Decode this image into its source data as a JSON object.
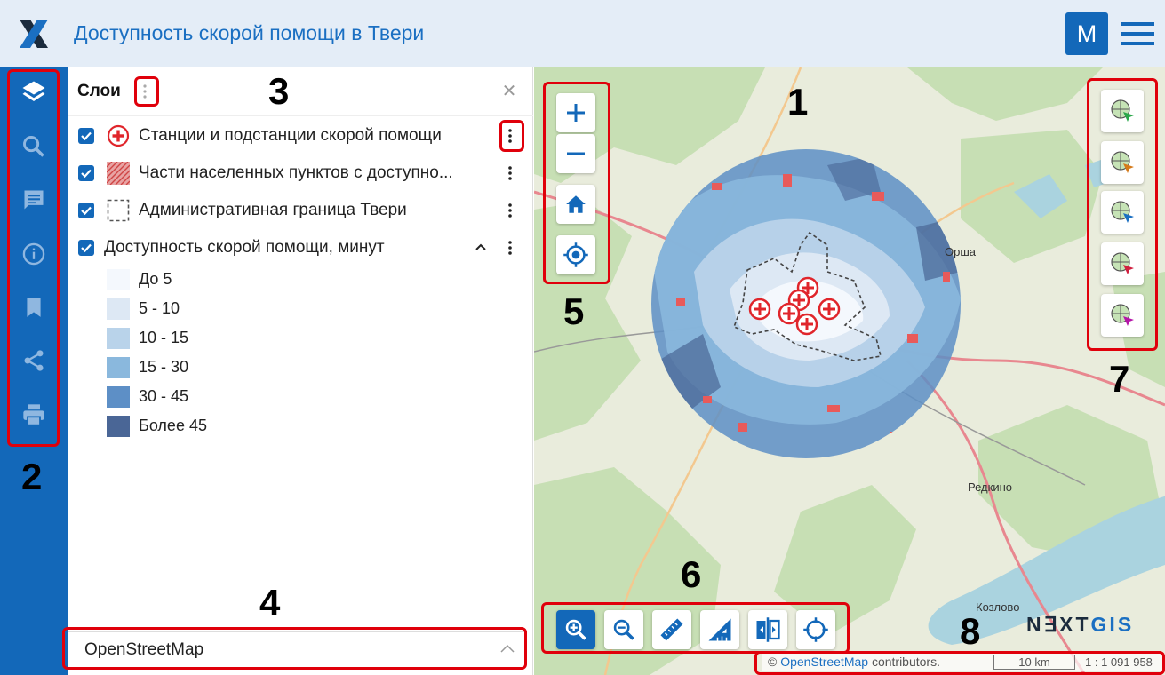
{
  "header": {
    "title": "Доступность скорой помощи в Твери",
    "avatar_letter": "M"
  },
  "panel": {
    "title": "Слои",
    "layers": [
      {
        "label": "Станции и подстанции скорой помощи",
        "checked": true,
        "icon": "ambulance-station-icon"
      },
      {
        "label": "Части населенных пунктов с доступно...",
        "checked": true,
        "icon": "hatched-polygon-icon"
      },
      {
        "label": "Административная граница Твери",
        "checked": true,
        "icon": "dashed-polygon-icon"
      },
      {
        "label": "Доступность скорой помощи, минут",
        "checked": true,
        "icon": "none"
      }
    ],
    "legend": [
      {
        "label": "До 5",
        "color": "#f4f8fd"
      },
      {
        "label": "5 - 10",
        "color": "#dde8f4"
      },
      {
        "label": "10 - 15",
        "color": "#b9d3ea"
      },
      {
        "label": "15 - 30",
        "color": "#8ab8dd"
      },
      {
        "label": "30 - 45",
        "color": "#5d8fc6"
      },
      {
        "label": "Более 45",
        "color": "#4a6696"
      }
    ]
  },
  "basemap": {
    "label": "OpenStreetMap"
  },
  "map": {
    "places": [
      "Орша",
      "Редкино",
      "Козлово"
    ],
    "attribution_prefix": "© ",
    "attribution_link": "OpenStreetMap",
    "attribution_suffix": " contributors.",
    "scale_label": "10 km",
    "scale_ratio": "1 : 1 091 958",
    "brand_prefix": "N∃XT",
    "brand_suffix": "GIS"
  },
  "annotations": [
    "1",
    "2",
    "3",
    "4",
    "5",
    "6",
    "7",
    "8"
  ],
  "colors": {
    "accent": "#1368b9",
    "header_bg": "#e4edf7",
    "highlight": "#e0000b"
  }
}
